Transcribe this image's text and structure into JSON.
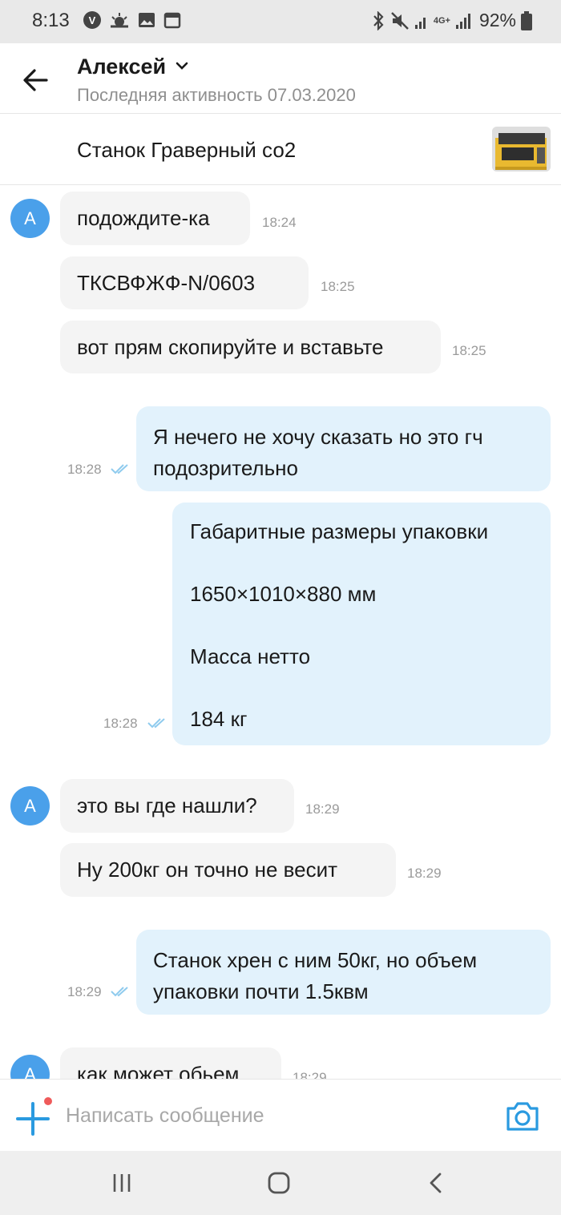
{
  "status_bar": {
    "time": "8:13",
    "carrier_badge": "V",
    "network_label": "4G+",
    "battery_percent": "92%"
  },
  "header": {
    "contact_name": "Алексей",
    "last_active": "Последняя активность 07.03.2020"
  },
  "listing": {
    "title": "Станок Граверный со2"
  },
  "chat": {
    "avatar_letter": "А",
    "messages": [
      {
        "direction": "in",
        "text": "подождите-ка",
        "time": "18:24"
      },
      {
        "direction": "in",
        "text": "ТКСВФЖФ-N/0603",
        "time": "18:25"
      },
      {
        "direction": "in",
        "text": "вот прям скопируйте и вставьте",
        "time": "18:25"
      },
      {
        "direction": "out",
        "text": "Я нечего не хочу сказать но это гч\nподозрительно",
        "time": "18:28"
      },
      {
        "direction": "out",
        "text": "Габаритные размеры упаковки\n\n1650×1010×880 мм\n\nМасса нетто\n\n184 кг",
        "time": "18:28"
      },
      {
        "direction": "in",
        "text": "это вы где нашли?",
        "time": "18:29"
      },
      {
        "direction": "in",
        "text": "Ну 200кг он точно не весит",
        "time": "18:29"
      },
      {
        "direction": "out",
        "text": "Станок хрен с ним 50кг, но объем\nупаковки почти 1.5квм",
        "time": "18:29"
      },
      {
        "direction": "in",
        "text": "как может обьем",
        "time": "18:29"
      }
    ]
  },
  "input_bar": {
    "placeholder": "Написать сообщение"
  },
  "colors": {
    "accent": "#2a9ae0",
    "avatar": "#4aa0ea",
    "incoming_bubble": "#f4f4f4",
    "outgoing_bubble": "#e2f2fc",
    "read_check": "#8fcbee",
    "notification_dot": "#ef5a5a"
  },
  "icons": {
    "back": "arrow-left-icon",
    "chevron": "chevron-down-icon",
    "add": "plus-icon",
    "camera": "camera-icon",
    "read": "double-check-icon"
  }
}
